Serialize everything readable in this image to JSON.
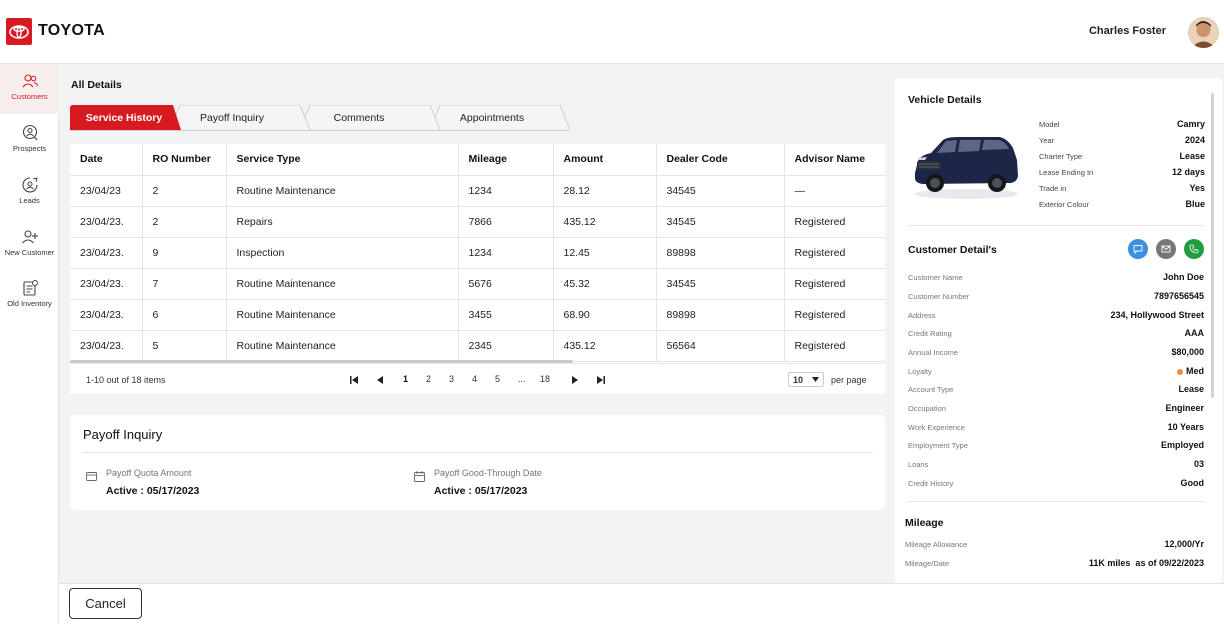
{
  "header": {
    "brand": "TOYOTA",
    "user_name": "Charles Foster"
  },
  "sidebar": {
    "items": [
      {
        "label": "Customers",
        "icon": "users-icon",
        "active": true
      },
      {
        "label": "Prospects",
        "icon": "search-user-icon",
        "active": false
      },
      {
        "label": "Leads",
        "icon": "leads-icon",
        "active": false
      },
      {
        "label": "New Customer",
        "icon": "add-user-icon",
        "active": false
      },
      {
        "label": "Old Inventory",
        "icon": "inventory-icon",
        "active": false
      }
    ]
  },
  "main": {
    "title": "All Details",
    "tabs": [
      {
        "label": "Service History",
        "active": true
      },
      {
        "label": "Payoff Inquiry",
        "active": false
      },
      {
        "label": "Comments",
        "active": false
      },
      {
        "label": "Appointments",
        "active": false
      }
    ],
    "table": {
      "columns": [
        "Date",
        "RO Number",
        "Service Type",
        "Mileage",
        "Amount",
        "Dealer Code",
        "Advisor Name"
      ],
      "rows": [
        [
          "23/04/23",
          "2",
          "Routine Maintenance",
          "1234",
          "28.12",
          "34545",
          "—"
        ],
        [
          "23/04/23.",
          "2",
          "Repairs",
          "7866",
          "435.12",
          "34545",
          "Registered"
        ],
        [
          "23/04/23.",
          "9",
          "Inspection",
          "1234",
          "12.45",
          "89898",
          "Registered"
        ],
        [
          "23/04/23.",
          "7",
          "Routine Maintenance",
          "5676",
          "45.32",
          "34545",
          "Registered"
        ],
        [
          "23/04/23.",
          "6",
          "Routine Maintenance",
          "3455",
          "68.90",
          "89898",
          "Registered"
        ],
        [
          "23/04/23.",
          "5",
          "Routine Maintenance",
          "2345",
          "435.12",
          "56564",
          "Registered"
        ]
      ]
    },
    "pagination": {
      "count_text": "1-10 out of 18 items",
      "pages": [
        "1",
        "2",
        "3",
        "4",
        "5",
        "...",
        "18"
      ],
      "current_page": "1",
      "per_page_value": "10",
      "per_page_label": "per page"
    },
    "payoff": {
      "title": "Payoff Inquiry",
      "quota_label": "Payoff Quota Amount",
      "quota_value": "Active : 05/17/2023",
      "through_label": "Payoff Good-Through Date",
      "through_value": "Active : 05/17/2023"
    }
  },
  "footer": {
    "cancel_label": "Cancel"
  },
  "vehicle": {
    "title": "Vehicle Details",
    "fields": [
      {
        "key": "Model",
        "value": "Camry"
      },
      {
        "key": "Year",
        "value": "2024"
      },
      {
        "key": "Charter Type",
        "value": "Lease"
      },
      {
        "key": "Lease Ending In",
        "value": "12 days"
      },
      {
        "key": "Trade in",
        "value": "Yes"
      },
      {
        "key": "Exterior Colour",
        "value": "Blue"
      }
    ]
  },
  "customer": {
    "title": "Customer Detail's",
    "fields": [
      {
        "key": "Customer Name",
        "value": "John Doe"
      },
      {
        "key": "Customer Number",
        "value": "7897656545"
      },
      {
        "key": "Address",
        "value": "234, Hollywood Street"
      },
      {
        "key": "Credit Rating",
        "value": "AAA"
      },
      {
        "key": "Annual Income",
        "value": "$80,000"
      },
      {
        "key": "Loyalty",
        "value": "Med"
      },
      {
        "key": "Account Type",
        "value": "Lease"
      },
      {
        "key": "Occupation",
        "value": "Engineer"
      },
      {
        "key": "Work Experience",
        "value": "10 Years"
      },
      {
        "key": "Employment Type",
        "value": "Employed"
      },
      {
        "key": "Loans",
        "value": "03"
      },
      {
        "key": "Credit History",
        "value": "Good"
      }
    ]
  },
  "mileage": {
    "title": "Mileage",
    "fields": [
      {
        "key": "Mileage Allowance",
        "value": "12,000/Yr"
      },
      {
        "key": "Mileage/Date",
        "value": "11K miles  as of 09/22/2023"
      }
    ]
  },
  "colors": {
    "brand_red": "#d71920",
    "chat_blue": "#3d8fe0",
    "mail_gray": "#777777",
    "call_green": "#1e9e3c",
    "loyalty_orange": "#f08a3a"
  }
}
